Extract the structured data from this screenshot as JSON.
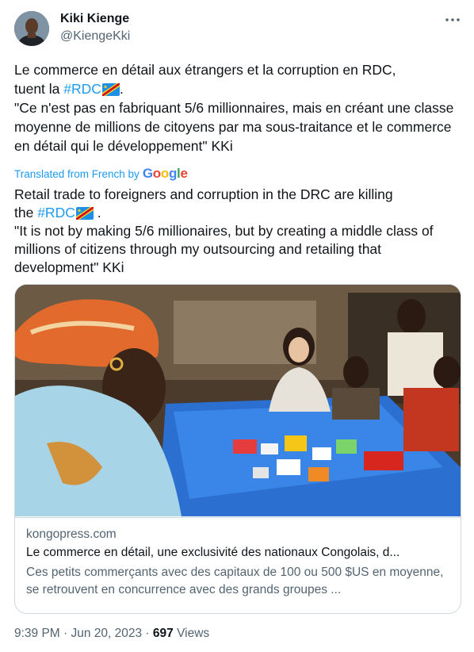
{
  "author": {
    "name": "Kiki Kienge",
    "handle": "@KiengeKki"
  },
  "tweet": {
    "line1_prefix": "Le commerce en détail aux étrangers et la corruption en RDC,",
    "line1_tuent": "tuent la ",
    "hashtag": "#RDC",
    "line1_end": ".",
    "quote": "\"Ce n'est pas en fabriquant 5/6 millionnaires, mais en créant une classe moyenne de millions de citoyens par ma sous-traitance et le commerce en détail qui le développement\" KKi"
  },
  "translation": {
    "label": "Translated from French by",
    "provider": [
      "G",
      "o",
      "o",
      "g",
      "l",
      "e"
    ],
    "line1": "Retail trade to foreigners and corruption in the DRC are killing",
    "line1_the": "the ",
    "hashtag": "#RDC",
    "line1_end": " .",
    "quote": "\"It is not by making 5/6 millionaires, but by creating a middle class of millions of citizens through my outsourcing and retailing that development\" KKi"
  },
  "link_card": {
    "domain": "kongopress.com",
    "title": "Le commerce en détail, une exclusivité des nationaux Congolais, d...",
    "description": "Ces petits commerçants avec des capitaux de 100 ou 500 $US en moyenne, se retrouvent en concurrence avec des grands groupes ..."
  },
  "meta": {
    "time": "9:39 PM · Jun 20, 2023 · ",
    "views_count": "697",
    "views_label": " Views"
  },
  "icons": {
    "more": "more-dots-icon",
    "flag": "drc-flag-icon"
  },
  "colors": {
    "link": "#1d9bf0",
    "secondary": "#536471",
    "border": "#cfd9de"
  }
}
